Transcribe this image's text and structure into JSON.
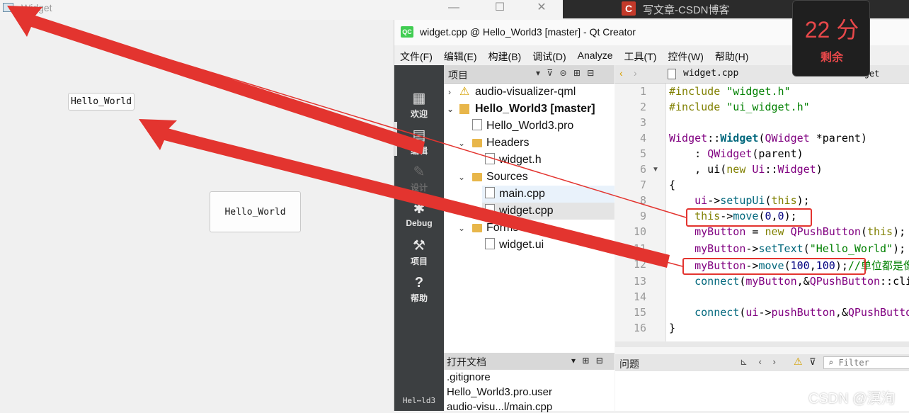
{
  "widget_window": {
    "title": "Widget",
    "btn1": "Hello_World",
    "btn2": "Hello_World",
    "min": "—",
    "max": "☐",
    "close": "✕"
  },
  "background": {
    "csdn_tab": "写文章-CSDN博客",
    "csdn_logo": "C"
  },
  "timer": {
    "value": "22 分",
    "label": "剩余"
  },
  "qt": {
    "title": "widget.cpp @ Hello_World3 [master] - Qt Creator",
    "logo": "QC",
    "menu": [
      "文件(F)",
      "编辑(E)",
      "构建(B)",
      "调试(D)",
      "Analyze",
      "工具(T)",
      "控件(W)",
      "帮助(H)"
    ],
    "sidebar": {
      "welcome": "欢迎",
      "edit": "编辑",
      "design": "设计",
      "debug": "Debug",
      "project": "项目",
      "help": "帮助",
      "session": "Hel⋯ld3"
    },
    "project_pane": {
      "title": "项目",
      "tree": [
        "audio-visualizer-qml",
        "Hello_World3 [master]",
        "Hello_World3.pro",
        "Headers",
        "widget.h",
        "Sources",
        "main.cpp",
        "widget.cpp",
        "Forms",
        "widget.ui"
      ]
    },
    "open_docs": {
      "title": "打开文档",
      "items": [
        ".gitignore",
        "Hello_World3.pro.user",
        "audio-visu...l/main.cpp"
      ]
    },
    "editor": {
      "file": "widget.cpp",
      "right_tab": "Widget",
      "line_numbers": [
        "1",
        "2",
        "3",
        "4",
        "5",
        "6",
        "7",
        "8",
        "9",
        "10",
        "11",
        "12",
        "13",
        "14",
        "15",
        "16"
      ]
    },
    "issues": {
      "title": "问题",
      "filter_placeholder": "Filter"
    }
  },
  "watermark": "CSDN @溟洵"
}
